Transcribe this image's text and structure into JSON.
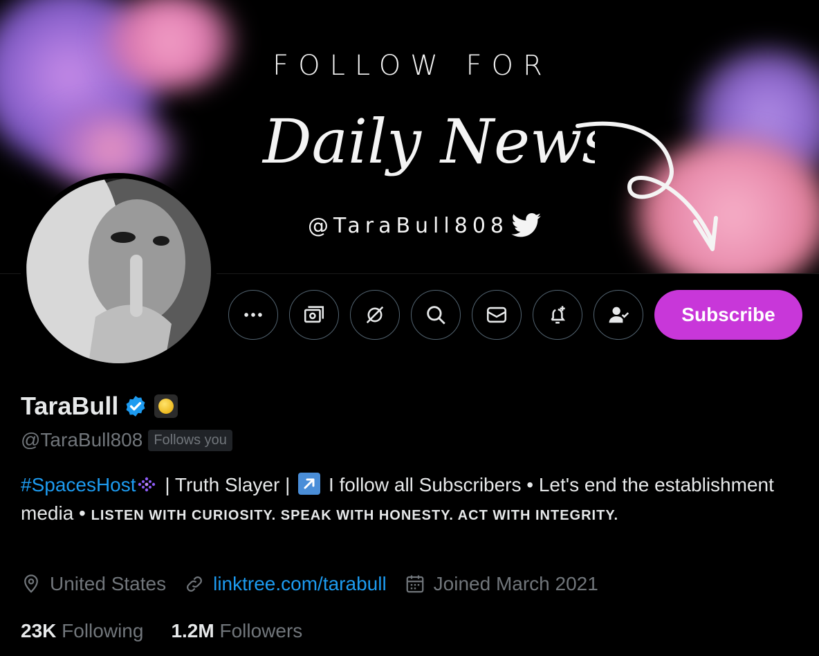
{
  "banner": {
    "top_text": "FOLLOW FOR",
    "script_text": "Daily News",
    "handle_text": "@TaraBull808"
  },
  "actions": {
    "more_icon": "more-icon",
    "subscribe_label": "Subscribe"
  },
  "profile": {
    "display_name": "TaraBull",
    "handle": "@TaraBull808",
    "follows_you": "Follows you"
  },
  "bio": {
    "hashtag": "#SpacesHost",
    "part1": " | Truth Slayer | ",
    "part2": " I follow all Subscribers • Let's end the establishment media • ",
    "caps": "LISTEN WITH CURIOSITY. SPEAK WITH HONESTY. ACT WITH INTEGRITY."
  },
  "meta": {
    "location": "United States",
    "link": "linktree.com/tarabull",
    "joined": "Joined March 2021"
  },
  "stats": {
    "following_count": "23K",
    "following_label": "Following",
    "followers_count": "1.2M",
    "followers_label": "Followers"
  },
  "colors": {
    "accent": "#1d9bf0",
    "subscribe": "#c837d9",
    "muted": "#71767b"
  }
}
